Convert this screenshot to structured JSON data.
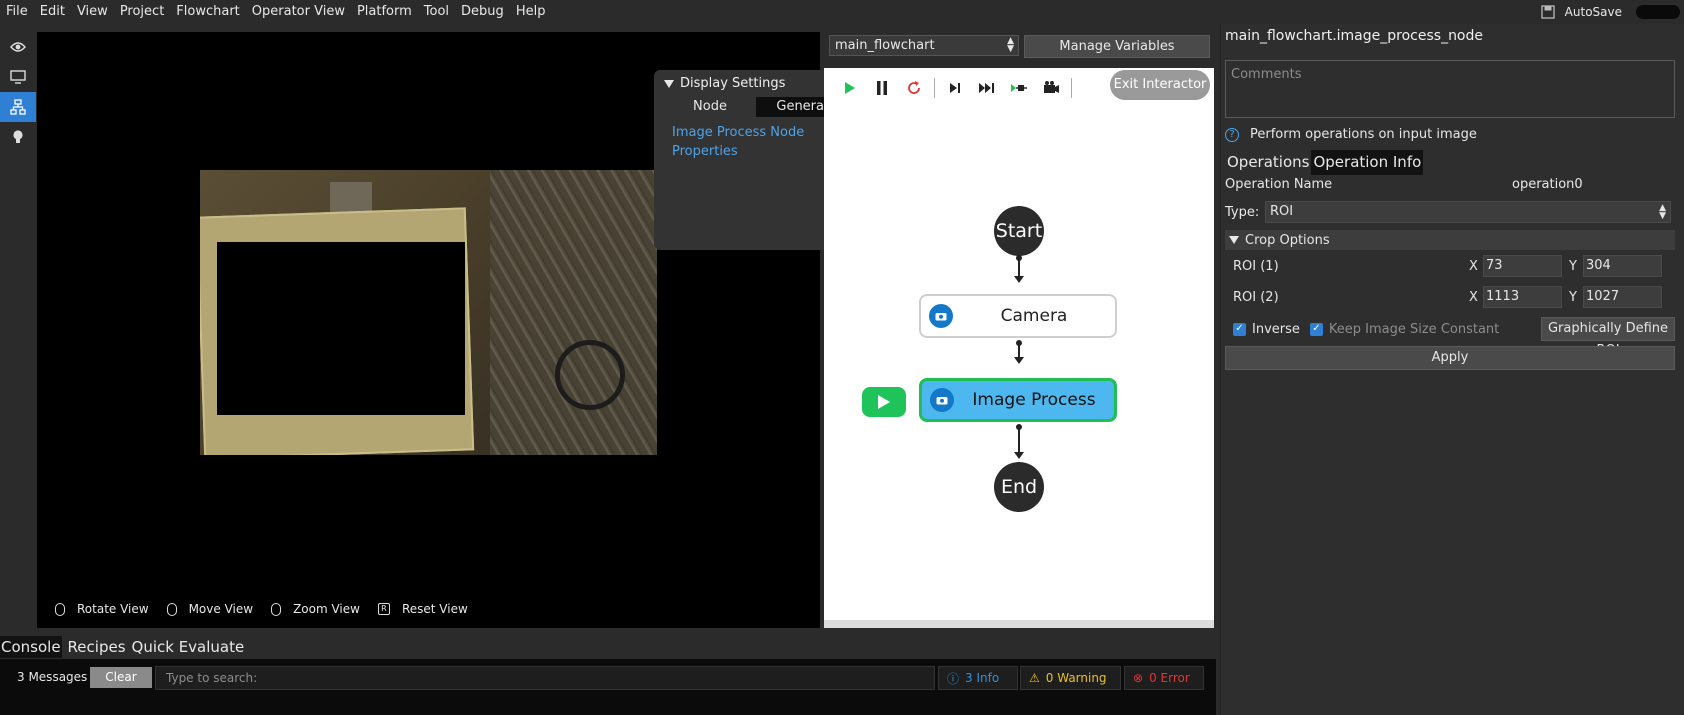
{
  "menu": [
    "File",
    "Edit",
    "View",
    "Project",
    "Flowchart",
    "Operator View",
    "Platform",
    "Tool",
    "Debug",
    "Help"
  ],
  "autosave_label": "AutoSave",
  "display_settings": {
    "header": "Display Settings",
    "tabs": [
      "Node",
      "General"
    ],
    "active_tab": "General",
    "link_text": "Image Process Node Properties"
  },
  "view_controls": [
    "Rotate View",
    "Move View",
    "Zoom View",
    "Reset View"
  ],
  "flowchart": {
    "selected_flowchart": "main_flowchart",
    "manage_variables": "Manage Variables",
    "exit_interactor": "Exit Interactor",
    "nodes": {
      "start": "Start",
      "camera": "Camera",
      "image_process": "Image Process",
      "end": "End"
    }
  },
  "properties": {
    "title": "main_flowchart.image_process_node",
    "comments_placeholder": "Comments",
    "help_text": "Perform operations on input image",
    "tabs": [
      "Operations",
      "Operation Info"
    ],
    "active_tab": "Operation Info",
    "operation_name_label": "Operation Name",
    "operation_name_value": "operation0",
    "type_label": "Type:",
    "type_value": "ROI",
    "crop_header": "Crop Options",
    "roi1": {
      "label": "ROI (1)",
      "x_label": "X",
      "x": "73",
      "y_label": "Y",
      "y": "304"
    },
    "roi2": {
      "label": "ROI (2)",
      "x_label": "X",
      "x": "1113",
      "y_label": "Y",
      "y": "1027"
    },
    "inverse_label": "Inverse",
    "keep_size_label": "Keep Image Size Constant",
    "graphically_define": "Graphically Define ROI",
    "apply": "Apply"
  },
  "console": {
    "tabs": [
      "Console",
      "Recipes",
      "Quick Evaluate"
    ],
    "active_tab": "Console",
    "message_count": "3 Messages",
    "clear": "Clear",
    "search_placeholder": "Type to search:",
    "info": "3 Info",
    "warning": "0 Warning",
    "error": "0 Error"
  },
  "colors": {
    "accent": "#2f7fd4",
    "selected_node": "#4db8ef",
    "run_green": "#1ec45a",
    "link_blue": "#4da3e8"
  }
}
